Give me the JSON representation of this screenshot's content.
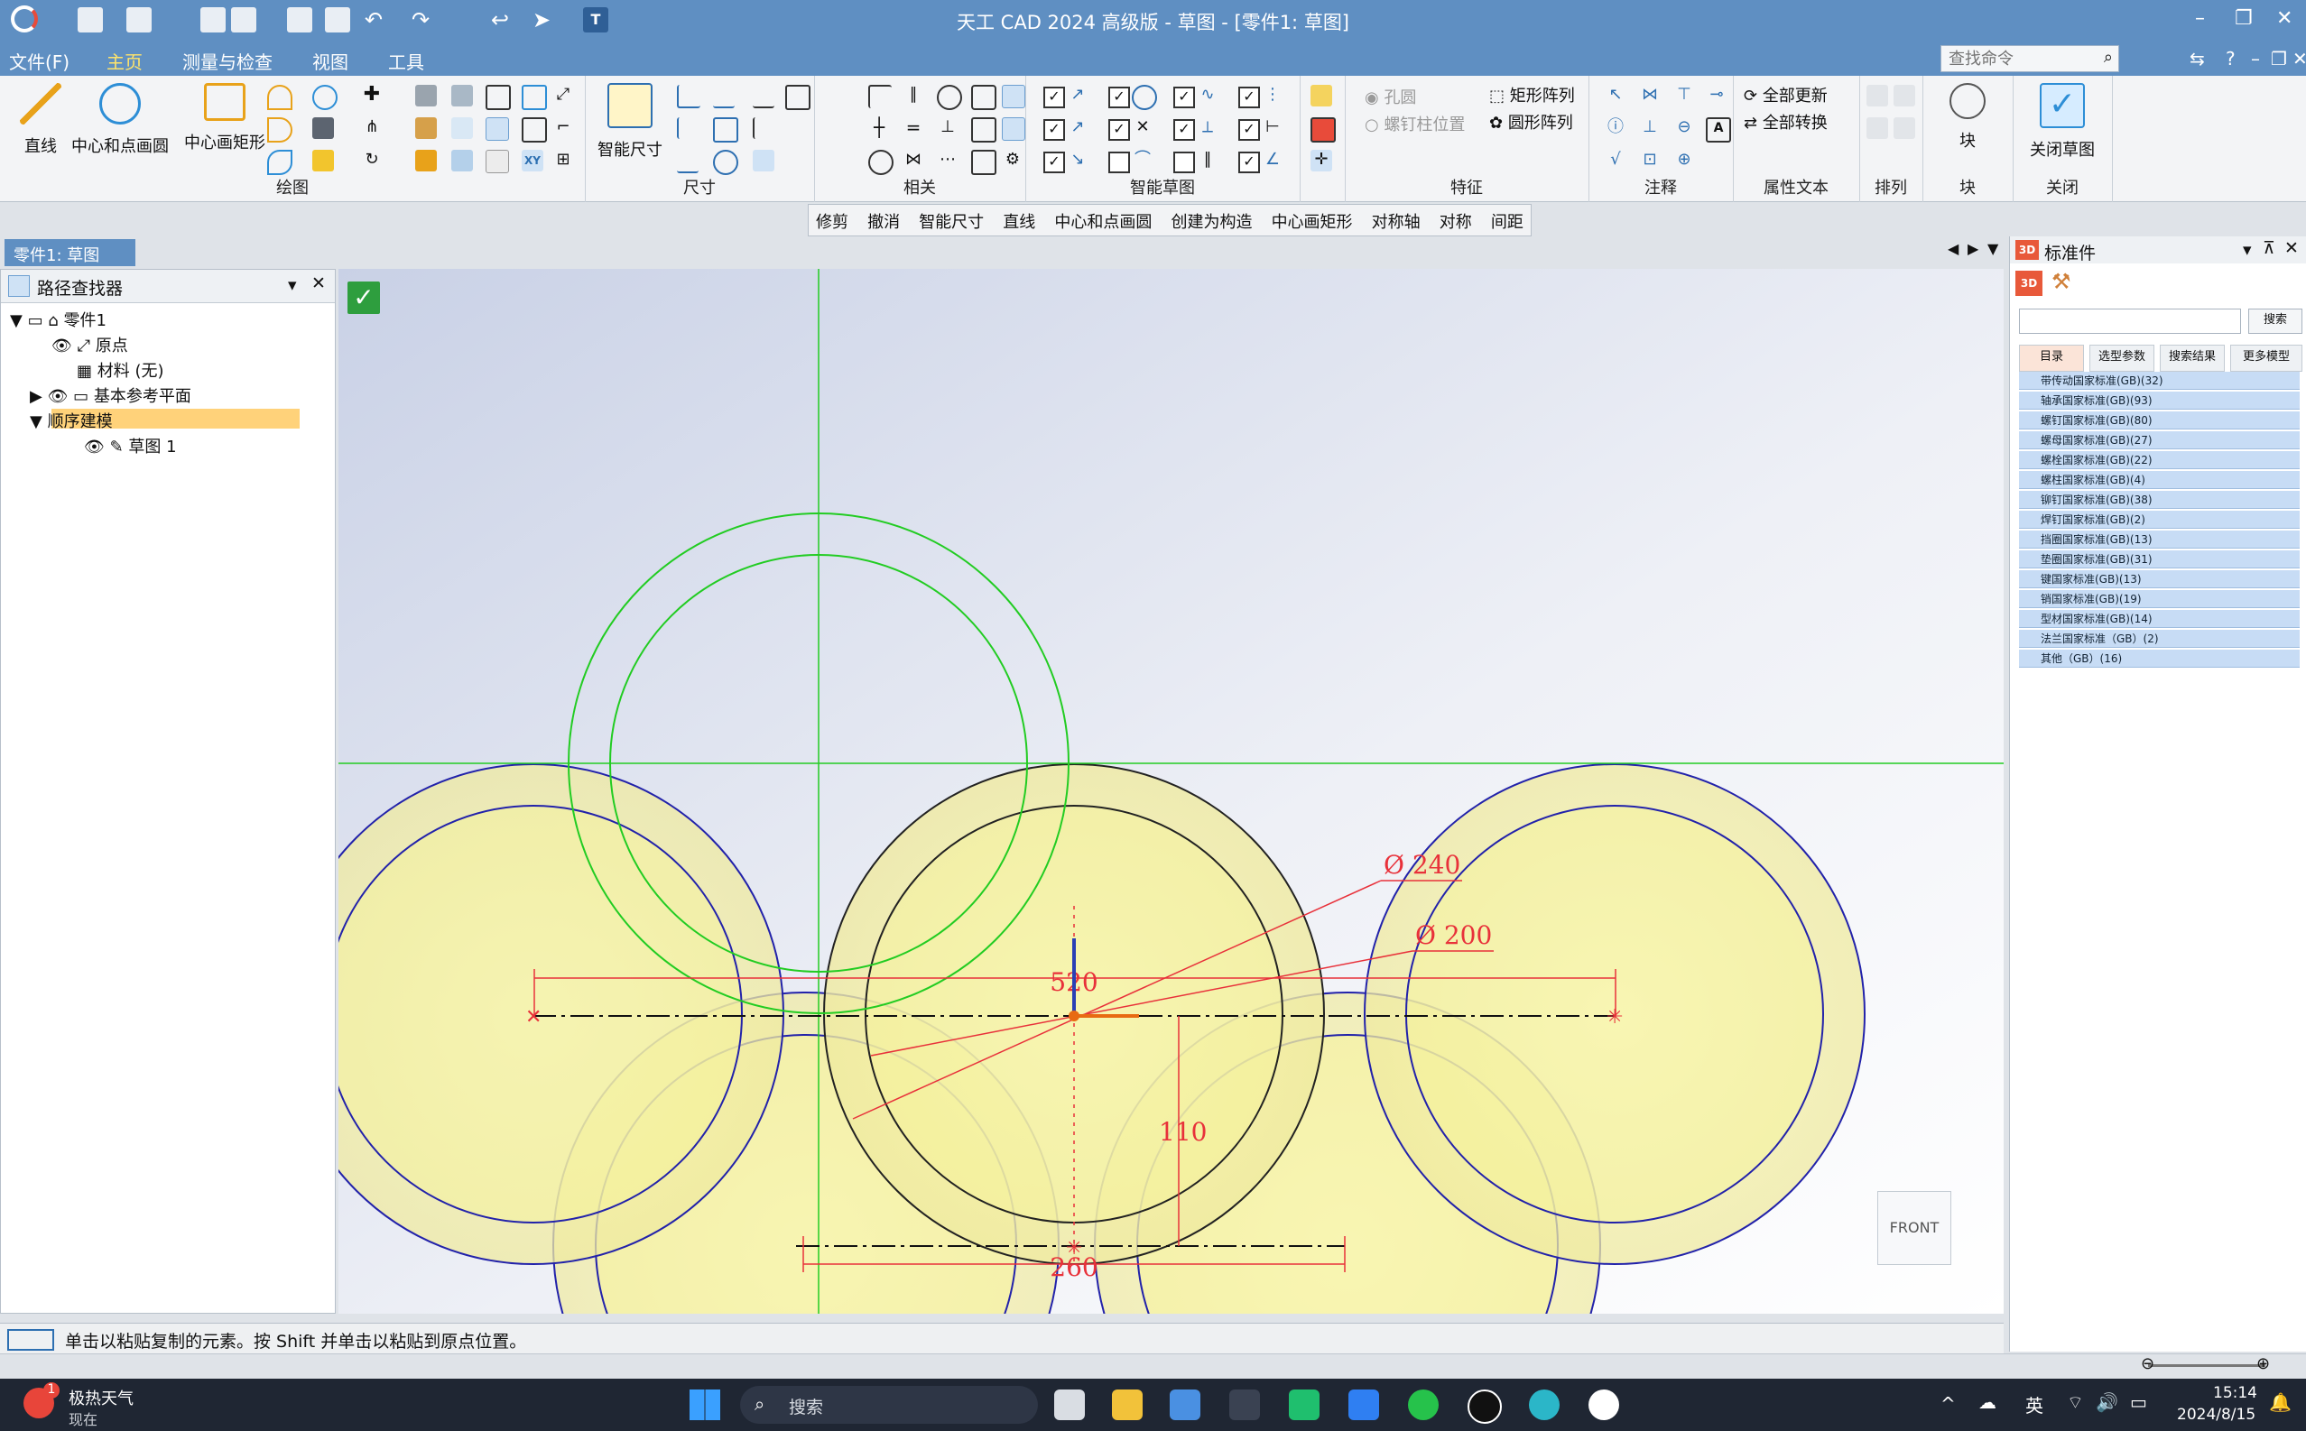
{
  "window": {
    "title": "天工 CAD 2024 高级版 - 草图 - [零件1: 草图]",
    "colors": {
      "titlebar": "#5f8fc2",
      "accent": "#ffe46b",
      "sketch_green": "#22cc22",
      "dimension_red": "#e8313a"
    }
  },
  "menu": [
    "文件(F)",
    "主页",
    "测量与检查",
    "视图",
    "工具"
  ],
  "menu_active": "主页",
  "search": {
    "placeholder": "查找命令"
  },
  "titlebar_right": {
    "help": "?",
    "minimize": "–",
    "restore": "❐",
    "close": "✕"
  },
  "ribbon": {
    "draw": {
      "label": "绘图",
      "line": "直线",
      "circle": "中心和点画圆",
      "rect": "中心画矩形"
    },
    "dimension": {
      "label": "尺寸",
      "smart": "智能尺寸"
    },
    "relate": {
      "label": "相关"
    },
    "smart_sketch": {
      "label": "智能草图"
    },
    "feature": {
      "label": "特征",
      "hole": "孔圆",
      "stud": "螺钉柱位置",
      "rect_array": "矩形阵列",
      "circ_array": "圆形阵列"
    },
    "annotation": {
      "label": "注释"
    },
    "attr_text": {
      "label": "属性文本",
      "update_all": "全部更新",
      "convert_all": "全部转换"
    },
    "arrange": {
      "label": "排列"
    },
    "block": {
      "label": "块",
      "block_btn": "块"
    },
    "close": {
      "label": "关闭",
      "close_sketch": "关闭草图"
    }
  },
  "subtoolbar": [
    "修剪",
    "撤消",
    "智能尺寸",
    "直线",
    "中心和点画圆",
    "创建为构造",
    "中心画矩形",
    "对称轴",
    "对称",
    "间距"
  ],
  "doc_tab": "零件1: 草图",
  "pathfinder": {
    "title": "路径查找器",
    "tree": [
      {
        "label": "零件1"
      },
      {
        "label": "原点"
      },
      {
        "label": "材料 (无)"
      },
      {
        "label": "基本参考平面"
      },
      {
        "label": "顺序建模"
      },
      {
        "label": "草图 1"
      }
    ]
  },
  "dimensions": {
    "d240": "Ø 240",
    "d200": "Ø 200",
    "w520": "520",
    "h110": "110",
    "w260": "260"
  },
  "view_cube": "FRONT",
  "status_text": "单击以粘贴复制的元素。按 Shift 并单击以粘贴到原点位置。",
  "std_parts": {
    "title": "标准件",
    "search_btn": "搜索",
    "tabs": [
      "目录",
      "选型参数",
      "搜索结果",
      "更多模型"
    ],
    "items": [
      "带传动国家标准(GB)(32)",
      "轴承国家标准(GB)(93)",
      "螺钉国家标准(GB)(80)",
      "螺母国家标准(GB)(27)",
      "螺栓国家标准(GB)(22)",
      "螺柱国家标准(GB)(4)",
      "铆钉国家标准(GB)(38)",
      "焊钉国家标准(GB)(2)",
      "挡圈国家标准(GB)(13)",
      "垫圈国家标准(GB)(31)",
      "键国家标准(GB)(13)",
      "销国家标准(GB)(19)",
      "型材国家标准(GB)(14)",
      "法兰国家标准（GB）(2)",
      "其他（GB）(16)"
    ]
  },
  "taskbar": {
    "weather_title": "极热天气",
    "weather_sub": "现在",
    "weather_badge": "1",
    "search": "搜索",
    "ime": "英",
    "time": "15:14",
    "date": "2024/8/15"
  }
}
